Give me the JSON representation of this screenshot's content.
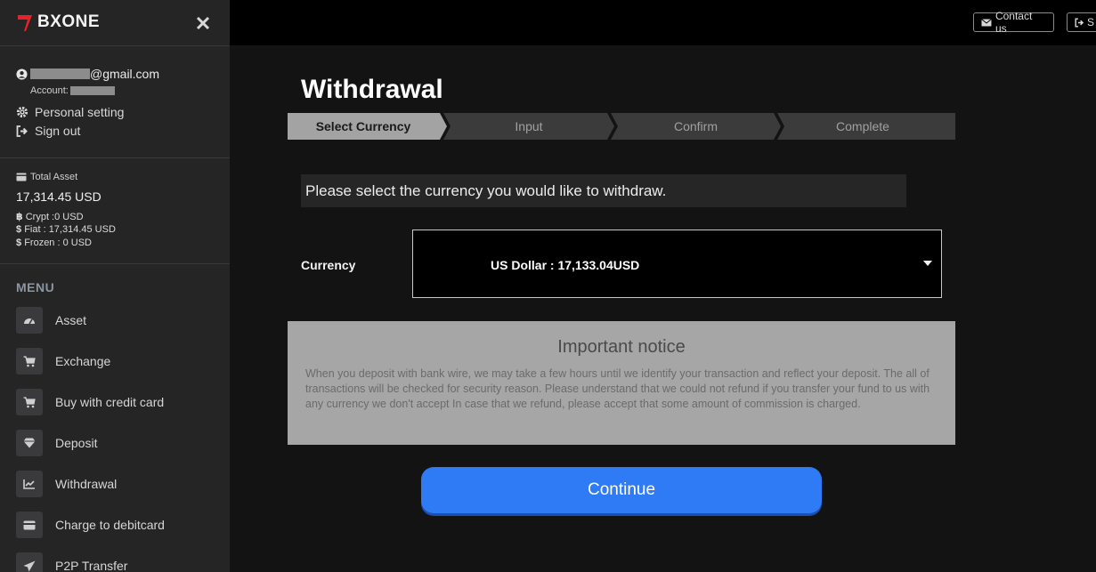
{
  "brand": {
    "name": "BXONE"
  },
  "user": {
    "email_suffix": "@gmail.com",
    "account_label": "Account:",
    "personal_setting": "Personal setting",
    "sign_out": "Sign out"
  },
  "assets": {
    "total_label": "Total Asset",
    "total_value": "17,314.45 USD",
    "crypt": "Crypt :0 USD",
    "fiat": "Fiat : 17,314.45 USD",
    "frozen": "Frozen : 0 USD"
  },
  "menu": {
    "heading": "MENU",
    "items": [
      {
        "label": "Asset",
        "icon": "gauge-icon"
      },
      {
        "label": "Exchange",
        "icon": "cart-icon"
      },
      {
        "label": "Buy with credit card",
        "icon": "cart-icon"
      },
      {
        "label": "Deposit",
        "icon": "diamond-icon"
      },
      {
        "label": "Withdrawal",
        "icon": "chart-icon"
      },
      {
        "label": "Charge to debitcard",
        "icon": "credit-card-icon"
      },
      {
        "label": "P2P Transfer",
        "icon": "paper-plane-icon"
      }
    ]
  },
  "topbar": {
    "contact_label": "Contact us",
    "second_label": "S"
  },
  "page": {
    "title": "Withdrawal",
    "steps": [
      "Select Currency",
      "Input",
      "Confirm",
      "Complete"
    ],
    "active_step": 0,
    "instruction": "Please select the currency you would like to withdraw.",
    "currency_label": "Currency",
    "currency_selected": "US Dollar : 17,133.04USD",
    "notice_title": "Important notice",
    "notice_body": "When you deposit with bank wire, we may take a few hours until we identify your transaction and reflect your deposit. The all of transactions will be checked for security reason. Please understand that we could not refund if you transfer your fund to us with any currency we don't accept In case that we refund, please accept that some amount of commission is charged.",
    "continue_label": "Continue"
  },
  "colors": {
    "accent": "#2f7bf5",
    "brand_red": "#e8212b",
    "sidebar_bg": "#252526",
    "step_active": "#a3a3a3",
    "step_inactive": "#3b3b3b"
  }
}
